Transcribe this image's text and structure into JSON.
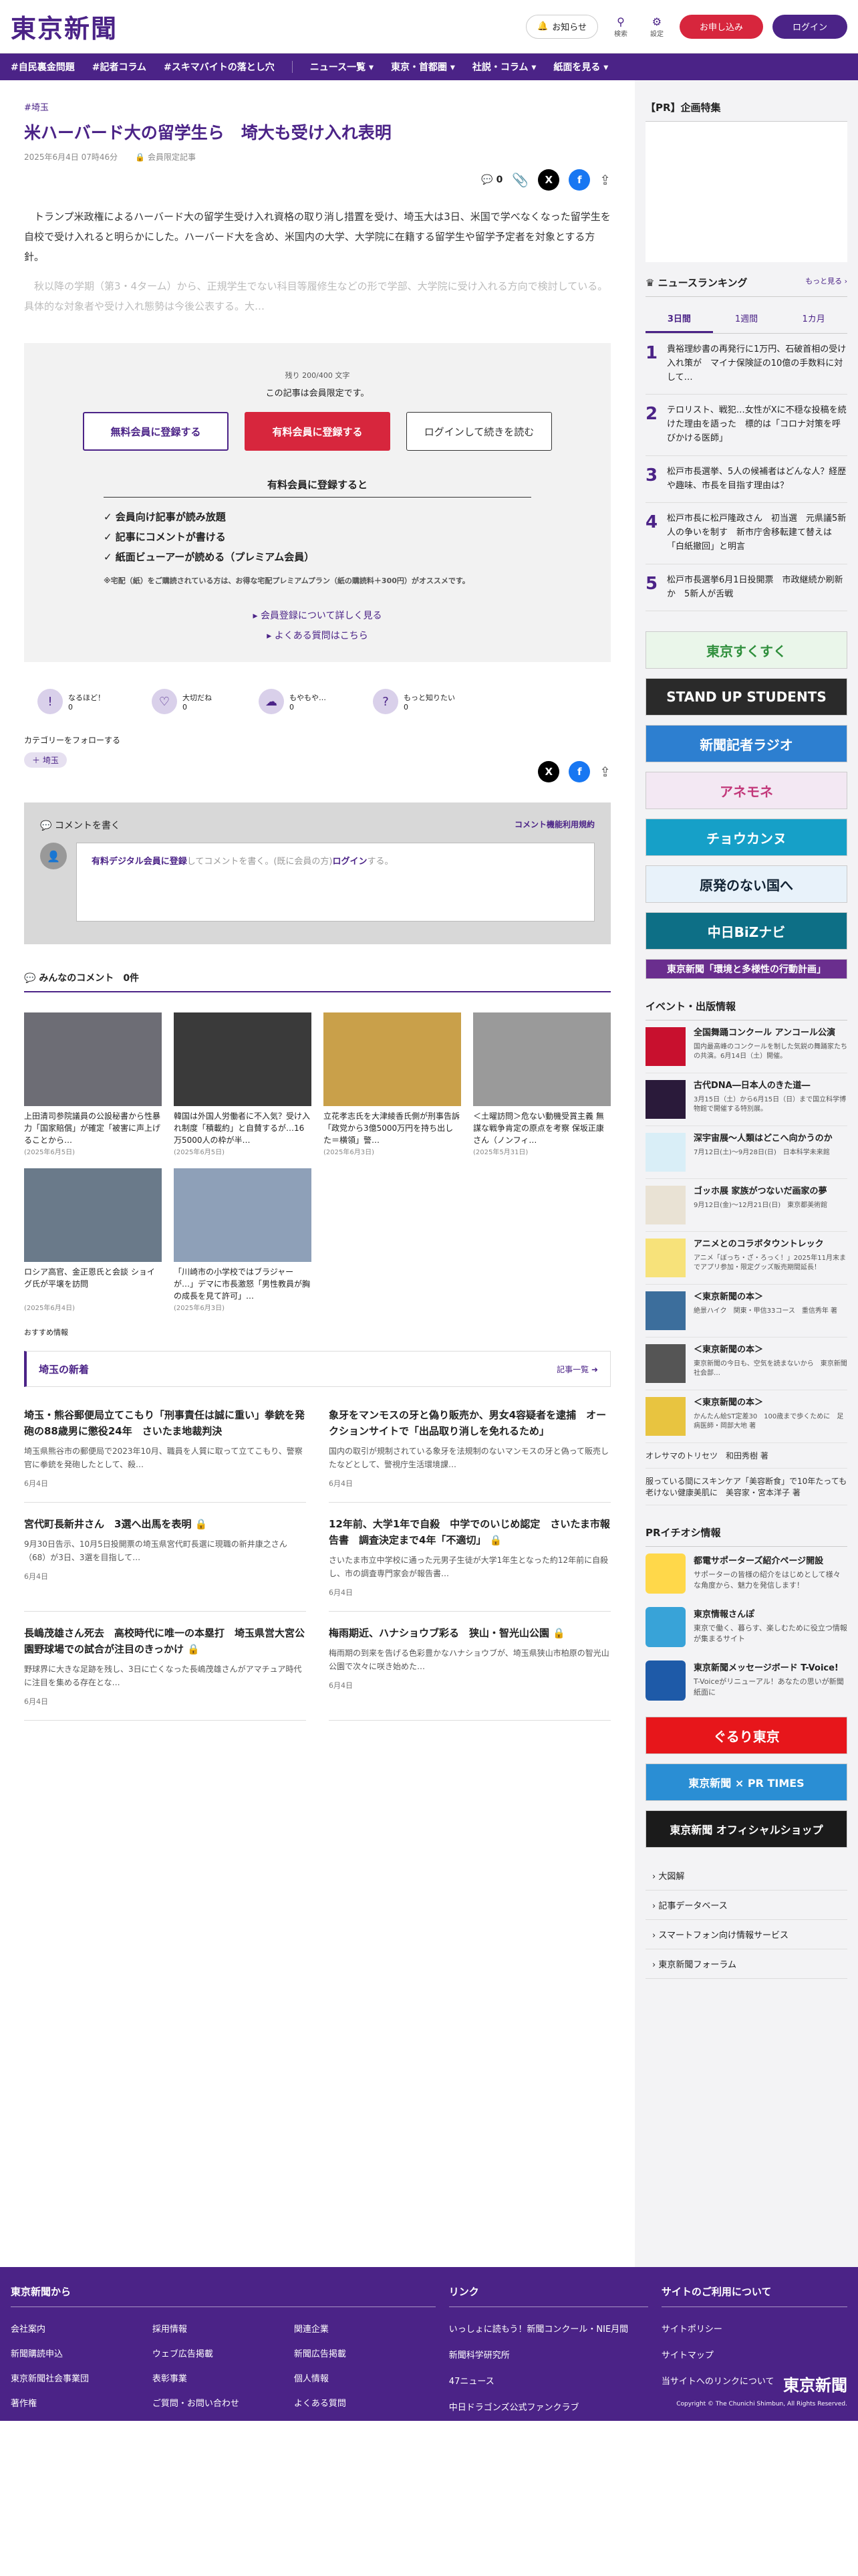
{
  "header": {
    "logo": "東京新聞",
    "notify": "お知らせ",
    "search": "検索",
    "settings": "設定",
    "apply": "お申し込み",
    "login": "ログイン"
  },
  "nav": [
    "#自民裏金問題",
    "#記者コラム",
    "#スキマバイトの落とし穴",
    "ニュース一覧",
    "東京・首都圏",
    "社説・コラム",
    "紙面を見る"
  ],
  "article": {
    "tag": "#埼玉",
    "title": "米ハーバード大の留学生ら　埼大も受け入れ表明",
    "date": "2025年6月4日 07時46分",
    "member": "会員限定記事",
    "like_count": "0",
    "p1": "トランプ米政権によるハーバード大の留学生受け入れ資格の取り消し措置を受け、埼玉大は3日、米国で学べなくなった留学生を自校で受け入れると明らかにした。ハーバード大を含め、米国内の大学、大学院に在籍する留学生や留学予定者を対象とする方針。",
    "p2": "秋以降の学期（第3・4ターム）から、正規学生でない科目等履修生などの形で学部、大学院に受け入れる方向で検討している。具体的な対象者や受け入れ態勢は今後公表する。大…"
  },
  "paywall": {
    "remaining": "残り 200/400 文字",
    "member_msg": "この記事は会員限定です。",
    "btn_free": "無料会員に登録する",
    "btn_paid": "有料会員に登録する",
    "btn_login": "ログインして続きを読む",
    "benefit_head": "有料会員に登録すると",
    "benefits": [
      "会員向け記事が読み放題",
      "記事にコメントが書ける",
      "紙面ビューアーが読める（プレミアム会員）"
    ],
    "note": "※宅配（紙）をご購読されている方は、お得な宅配プレミアムプラン（紙の購読料＋300円）がオススメです。",
    "link1": "会員登録について詳しく見る",
    "link2": "よくある質問はこちら"
  },
  "reactions": [
    {
      "label": "なるほど！",
      "count": "0"
    },
    {
      "label": "大切だね",
      "count": "0"
    },
    {
      "label": "もやもや…",
      "count": "0"
    },
    {
      "label": "もっと知りたい",
      "count": "0"
    }
  ],
  "follow": {
    "title": "カテゴリーをフォローする",
    "chip": "＋ 埼玉"
  },
  "comments": {
    "write": "コメントを書く",
    "rules": "コメント機能利用規約",
    "prompt_a": "有料デジタル会員に登録",
    "prompt_b": "してコメントを書く。(既に会員の方)",
    "prompt_c": "ログイン",
    "prompt_d": "する。",
    "all": "みんなのコメント",
    "count": "0件"
  },
  "related": [
    {
      "title": "上田清司参院議員の公設秘書から性暴力「国家賠償」が確定「被害に声上げることから…",
      "date": "(2025年6月5日)",
      "color": "#6d6d75"
    },
    {
      "title": "韓国は外国人労働者に不入気？受け入れ制度「積載約」と自賛するが…16万5000人の枠が半…",
      "date": "(2025年6月5日)",
      "color": "#3a3a3a"
    },
    {
      "title": "立花孝志氏を大津綾香氏側が刑事告訴「政党から3億5000万円を持ち出した＝横領」警…",
      "date": "(2025年6月3日)",
      "color": "#c9a04a"
    },
    {
      "title": "＜土曜訪問＞危ない動機受賞主義 無謀な戦争肯定の原点を考察 保坂正康さん（ノンフィ…",
      "date": "(2025年5月31日)",
      "color": "#9a9a9a"
    },
    {
      "title": "ロシア高官、金正恩氏と会談 ショイグ氏が平壌を訪問",
      "date": "(2025年6月4日)",
      "color": "#6a7a8a"
    },
    {
      "title": "「川崎市の小学校ではブラジャーが…」デマに市長激怒「男性教員が胸の成長を見て許可」…",
      "date": "(2025年6月3日)",
      "color": "#8ea0b8"
    }
  ],
  "recmark": "おすすめ情報",
  "saitama": {
    "title": "埼玉の新着",
    "more": "記事一覧",
    "items": [
      {
        "title": "埼玉・熊谷郵便局立てこもり「刑事責任は誠に重い」拳銃を発砲の88歳男に懲役24年　さいたま地裁判決",
        "body": "埼玉県熊谷市の郵便局で2023年10月、職員を人質に取って立てこもり、警察官に拳銃を発砲したとして、殺…",
        "date": "6月4日",
        "lock": false
      },
      {
        "title": "象牙をマンモスの牙と偽り販売か、男女4容疑者を逮捕　オークションサイトで「出品取り消しを免れるため」",
        "body": "国内の取引が規制されている象牙を法規制のないマンモスの牙と偽って販売したなどとして、警視庁生活環境課…",
        "date": "6月4日",
        "lock": false
      },
      {
        "title": "宮代町長新井さん　3選へ出馬を表明",
        "body": "9月30日告示、10月5日投開票の埼玉県宮代町長選に現職の新井康之さん（68）が3日、3選を目指して…",
        "date": "6月4日",
        "lock": true
      },
      {
        "title": "12年前、大学1年で自殺　中学でのいじめ認定　さいたま市報告書　調査決定まで4年「不適切」",
        "body": "さいたま市立中学校に通った元男子生徒が大学1年生となった約12年前に自殺し、市の調査専門家会が報告書…",
        "date": "6月4日",
        "lock": true
      },
      {
        "title": "長嶋茂雄さん死去　高校時代に唯一の本塁打　埼玉県営大宮公園野球場での試合が注目のきっかけ",
        "body": "野球界に大きな足跡を残し、3日に亡くなった長嶋茂雄さんがアマチュア時代に注目を集める存在とな…",
        "date": "6月4日",
        "lock": true
      },
      {
        "title": "梅雨期近、ハナショウブ彩る　狭山・智光山公園",
        "body": "梅雨期の到来を告げる色彩豊かなハナショウブが、埼玉県狭山市柏原の智光山公園で次々に咲き始めた…",
        "date": "6月4日",
        "lock": true
      }
    ]
  },
  "side": {
    "special": "【PR】企画特集",
    "ranking_title": "ニュースランキング",
    "ranking_more": "もっと見る",
    "tabs": [
      "3日間",
      "1週間",
      "1カ月"
    ],
    "ranking": [
      {
        "n": "1",
        "t": "貴裕理紗書の再発行に1万円、石破首相の受け入れ策が　マイナ保険証の10億の手数料に対して…"
      },
      {
        "n": "2",
        "t": "テロリスト、戦犯…女性がXに不穏な投稿を続けた理由を語った　標的は「コロナ対策を呼びかける医師」"
      },
      {
        "n": "3",
        "t": "松戸市長選挙、5人の候補者はどんな人？経歴や趣味、市長を目指す理由は？"
      },
      {
        "n": "4",
        "t": "松戸市長に松戸隆政さん　初当選　元県議5新人の争いを制す　新市庁舎移転建て替えは「白紙撤回」と明言"
      },
      {
        "n": "5",
        "t": "松戸市長選挙6月1日投開票　市政継続か刷新か　5新人が舌戦"
      }
    ],
    "banners": [
      {
        "t": "東京すくすく",
        "bg": "#eaf6ea",
        "fg": "#2f8f3c"
      },
      {
        "t": "STAND UP STUDENTS",
        "bg": "#2a2a2a",
        "fg": "#fff"
      },
      {
        "t": "新聞記者ラジオ",
        "bg": "#2d7fd0",
        "fg": "#fff"
      },
      {
        "t": "アネモネ",
        "bg": "#f3e8f3",
        "fg": "#c2387a"
      },
      {
        "t": "チョウカンヌ",
        "bg": "#16a0c8",
        "fg": "#fff"
      },
      {
        "t": "原発のない国へ",
        "bg": "#e8f2fa",
        "fg": "#123"
      },
      {
        "t": "中日BiZナビ",
        "bg": "#0d6f86",
        "fg": "#fff"
      },
      {
        "t": "東京新聞「環境と多様性の行動計画」",
        "bg": "#6a2e8e",
        "fg": "#fff"
      }
    ],
    "events_title": "イベント・出版情報",
    "events": [
      {
        "t": "全国舞踊コンクール アンコール公演",
        "d": "国内最高峰のコンクールを制した気鋭の舞踊家たちの共演。6月14日（土）開催。",
        "c": "#c8102e"
      },
      {
        "t": "古代DNA―日本人のきた道―",
        "d": "3月15日（土）から6月15日（日）まで国立科学博物館で開催する特別展。",
        "c": "#2a1a3a"
      },
      {
        "t": "深宇宙展～人類はどこへ向かうのか",
        "d": "7月12日(土)～9月28日(日)　日本科学未来館",
        "c": "#d9eef7"
      },
      {
        "t": "ゴッホ展 家族がつないだ画家の夢",
        "d": "9月12日(金)～12月21日(日)　東京都美術館",
        "c": "#e9e2d4"
      },
      {
        "t": "アニメとのコラボタウントレック",
        "d": "アニメ「ぼっち・ざ・ろっく！」2025年11月末までアプリ参加・限定グッズ販売期間延長！",
        "c": "#f7e27a"
      },
      {
        "t": "＜東京新聞の本＞",
        "d": "絶景ハイク　関東・甲信33コース　重信秀年 著",
        "c": "#3c6e9c"
      },
      {
        "t": "＜東京新聞の本＞",
        "d": "東京新聞の今日も、空気を読まないから　東京新聞社会部…",
        "c": "#555"
      },
      {
        "t": "＜東京新聞の本＞",
        "d": "かんたん絵ST定差30　100歳まで歩くために　足病医師・岡部大地 著",
        "c": "#e8c440"
      }
    ],
    "ev_links": [
      "オレサマのトリセツ　和田秀樹 著",
      "服っている間にスキンケア「美容断食」で10年たっても老けない健康美肌に　美容家・宮本洋子 著"
    ],
    "pr_title": "PRイチオシ情報",
    "pr": [
      {
        "t": "都電サポーターズ紹介ページ開設",
        "d": "サポーターの皆様の紹介をはじめとして様々な角度から、魅力を発信します！",
        "c": "#ffd84a"
      },
      {
        "t": "東京情報さんぽ",
        "d": "東京で働く、暮らす、楽しむために役立つ情報が集まるサイト",
        "c": "#38a3d8"
      },
      {
        "t": "東京新聞メッセージボード T-Voice!",
        "d": "T-Voiceがリニューアル！あなたの思いが新聞紙面に",
        "c": "#1e5aa8"
      }
    ],
    "pr_banners": [
      {
        "t": "ぐるり東京",
        "bg": "#e7161b",
        "fg": "#fff"
      },
      {
        "t": "東京新聞 × PR TIMES",
        "bg": "#2a8ed4",
        "fg": "#fff"
      },
      {
        "t": "東京新聞 オフィシャルショップ",
        "bg": "#1b1b1b",
        "fg": "#fff"
      }
    ],
    "links": [
      "大図解",
      "記事データベース",
      "スマートフォン向け情報サービス",
      "東京新聞フォーラム"
    ]
  },
  "footer": {
    "col1": "東京新聞から",
    "col1_items": [
      "会社案内",
      "採用情報",
      "関連企業",
      "新聞購読申込",
      "ウェブ広告掲載",
      "新聞広告掲載",
      "東京新聞社会事業団",
      "表彰事業",
      "個人情報",
      "著作権",
      "ご質問・お問い合わせ",
      "よくある質問"
    ],
    "col2": "リンク",
    "col2_items": [
      "いっしょに読もう！新聞コンクール・NIE月間",
      "新聞科学研究所",
      "47ニュース",
      "中日ドラゴンズ公式ファンクラブ"
    ],
    "col3": "サイトのご利用について",
    "col3_items": [
      "サイトポリシー",
      "サイトマップ",
      "当サイトへのリンクについて"
    ],
    "logo": "東京新聞",
    "copyright": "Copyright © The Chunichi Shimbun, All Rights Reserved."
  }
}
